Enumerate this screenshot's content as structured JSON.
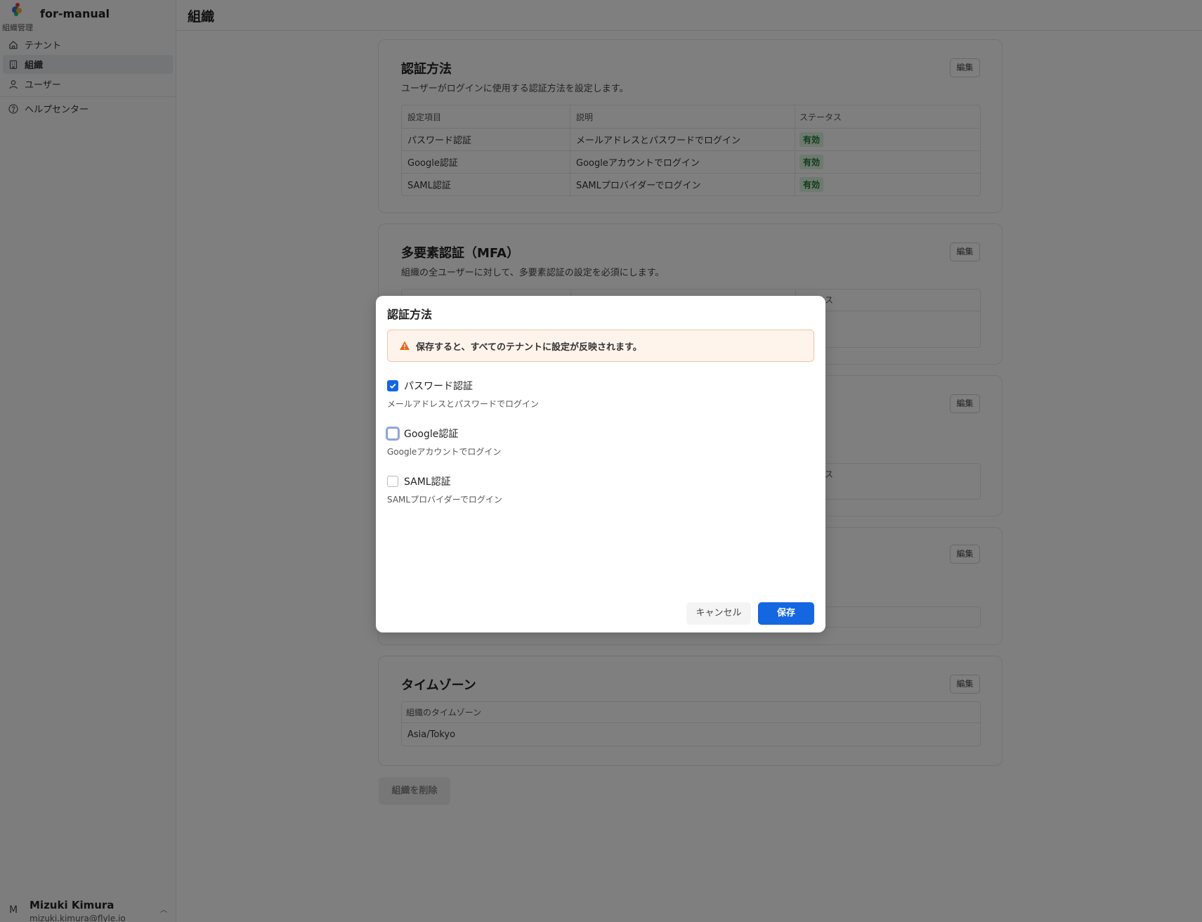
{
  "app": {
    "name": "for-manual",
    "section_label": "組織管理"
  },
  "sidebar": {
    "items": [
      {
        "label": "テナント",
        "icon": "home-icon",
        "active": false
      },
      {
        "label": "組織",
        "icon": "building-icon",
        "active": true
      },
      {
        "label": "ユーザー",
        "icon": "user-icon",
        "active": false
      }
    ],
    "help": {
      "label": "ヘルプセンター",
      "icon": "help-circle-icon"
    }
  },
  "user": {
    "initial": "M",
    "name": "Mizuki Kimura",
    "email": "mizuki.kimura@flyle.io"
  },
  "header": {
    "title": "組織"
  },
  "cards": {
    "auth": {
      "title": "認証方法",
      "description": "ユーザーがログインに使用する認証方法を設定します。",
      "edit_label": "編集",
      "columns": [
        "設定項目",
        "説明",
        "ステータス"
      ],
      "rows": [
        {
          "item": "パスワード認証",
          "desc": "メールアドレスとパスワードでログイン",
          "status": "有効"
        },
        {
          "item": "Google認証",
          "desc": "Googleアカウントでログイン",
          "status": "有効"
        },
        {
          "item": "SAML認証",
          "desc": "SAMLプロバイダーでログイン",
          "status": "有効"
        }
      ]
    },
    "mfa": {
      "title": "多要素認証（MFA）",
      "description": "組織の全ユーザーに対して、多要素認証の設定を必須にします。",
      "edit_label": "編集",
      "partial_header": "タス"
    },
    "card3": {
      "edit_label": "編集",
      "partial_header": "タス"
    },
    "card4": {
      "edit_label": "編集"
    },
    "timezone": {
      "title": "タイムゾーン",
      "edit_label": "編集",
      "column": "組織のタイムゾーン",
      "value": "Asia/Tokyo"
    }
  },
  "delete_button": "組織を削除",
  "modal": {
    "title": "認証方法",
    "warning": "保存すると、すべてのテナントに設定が反映されます。",
    "options": [
      {
        "label": "パスワード認証",
        "description": "メールアドレスとパスワードでログイン",
        "checked": true
      },
      {
        "label": "Google認証",
        "description": "Googleアカウントでログイン",
        "checked": false
      },
      {
        "label": "SAML認証",
        "description": "SAMLプロバイダーでログイン",
        "checked": false
      }
    ],
    "cancel_label": "キャンセル",
    "save_label": "保存"
  },
  "colors": {
    "primary": "#1467e0",
    "badge_bg": "#dcf3e0",
    "badge_text": "#1e7a33",
    "warning_bg": "#fff4ec",
    "warning_border": "#f3c3a3",
    "warning_icon": "#e8641a"
  }
}
